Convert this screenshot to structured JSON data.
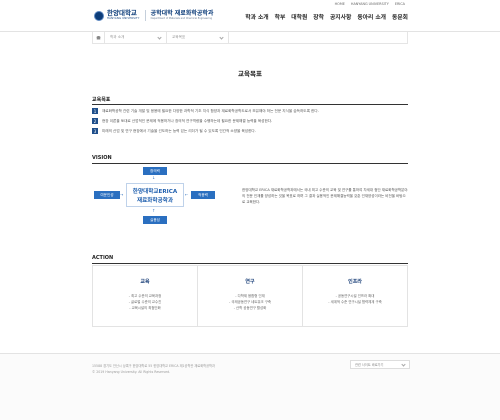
{
  "util_links": [
    "HOME",
    "HANYANG UNIVERSITY",
    "ERICA"
  ],
  "logo": {
    "univ_ko": "한양대학교",
    "univ_en": "HANYANG UNIVERSITY",
    "dept_ko": "공학대학 재료화학공학과",
    "dept_en": "Department of Materials and Chemical Engineering"
  },
  "gnb": [
    "학과 소개",
    "학부",
    "대학원",
    "장학",
    "공지사항",
    "동아리 소개",
    "동문회"
  ],
  "location": {
    "item1": "학과 소개",
    "item2": "교육목표"
  },
  "page_title": "교육목표",
  "goals": {
    "title": "교육목표",
    "items": [
      {
        "num": "1",
        "text": "재료화학공학 관련 기술 개발 및 응용에 필요한 다양한 과학적 기초 지식 함양과 재료화학공학도로서 보유해야 하는 전문 지식을 습득하도록 한다."
      },
      {
        "num": "2",
        "text": "현장 이론을 토대로 산업적인 문제에 적용하거나 창의적 연구역량을 수행하는데 필요한 문제해결 능력을 육성한다."
      },
      {
        "num": "3",
        "text": "미래의 산업 및 연구 현장에서 기술을 선도하는 능력 있는 리더가 될 수 있도록 인간적 소양을 육성한다."
      }
    ]
  },
  "vision": {
    "title": "VISION",
    "top": "창의력",
    "left": "여운인성",
    "right": "적응력",
    "bottom": "실용성",
    "center_line1": "한양대학교ERICA",
    "center_line2": "재료화학공학과",
    "text": "한양대학교 ERICA 재료화학공학과에서는 국내 최고 수준의 교육 및 연구를 통하여 차세대 첨단 재료화학공학분야의 전문 인재를 양성하는 것을 목표로 하며 그 결과 실용적인 문제해결능력을 갖춘 인재양성이라는 비전을 바탕으로 교육한다."
  },
  "action": {
    "title": "ACTION",
    "columns": [
      {
        "title": "교육",
        "items": [
          "최고 수준의 교육과정",
          "글로벌 수준의 교수진",
          "교육시설의 최첨단화"
        ]
      },
      {
        "title": "연구",
        "items": [
          "다학제 융합형 인재",
          "국제공동연구 네트워크 구축",
          "산학 공동연구 활성화"
        ]
      },
      {
        "title": "인프라",
        "items": [
          "공동연구시설 인프라 확대",
          "세계적 수준 연구시설 협력체계 구축"
        ]
      }
    ]
  },
  "footer": {
    "address": "15588 경기도 안산시 상록구 한양대학로 55 한양대학교 ERICA 제1공학관 재료화학공학과",
    "copyright": "© 2019 Hanyang University. All Rights Reserved.",
    "family_site": "관련 사이트 바로가기"
  }
}
